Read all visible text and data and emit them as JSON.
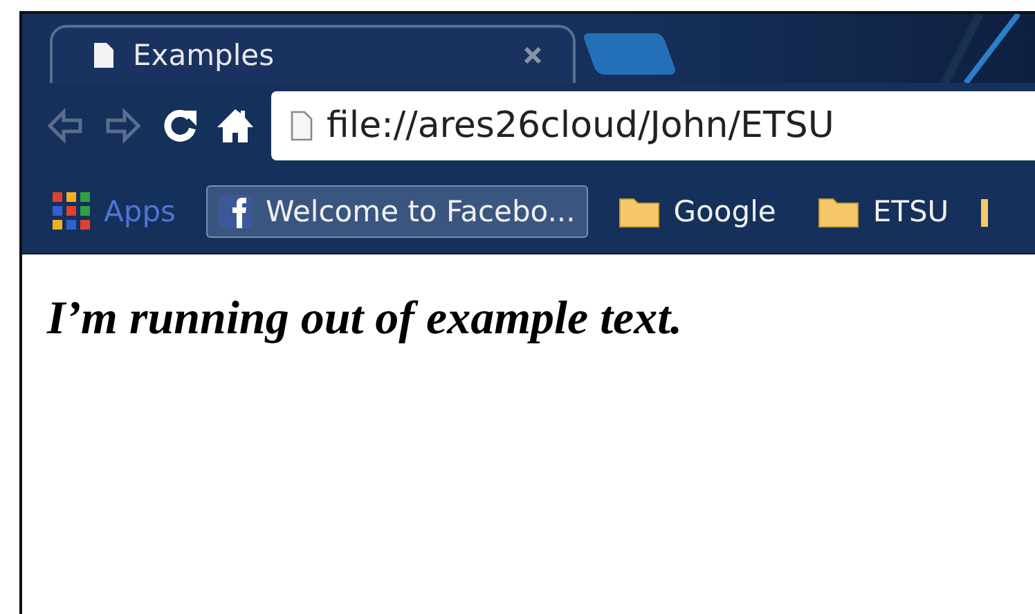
{
  "tabs": [
    {
      "title": "Examples",
      "selected": true
    }
  ],
  "toolbar": {
    "back_disabled": true,
    "forward_disabled": true,
    "address": "file://ares26cloud/John/ETSU"
  },
  "bookmarks": [
    {
      "kind": "apps",
      "label": "Apps"
    },
    {
      "kind": "site",
      "label": "Welcome to Facebo...",
      "selected": true
    },
    {
      "kind": "folder",
      "label": "Google",
      "selected": false
    },
    {
      "kind": "folder",
      "label": "ETSU",
      "selected": false
    }
  ],
  "content": {
    "text": "I’m running out of example text."
  }
}
